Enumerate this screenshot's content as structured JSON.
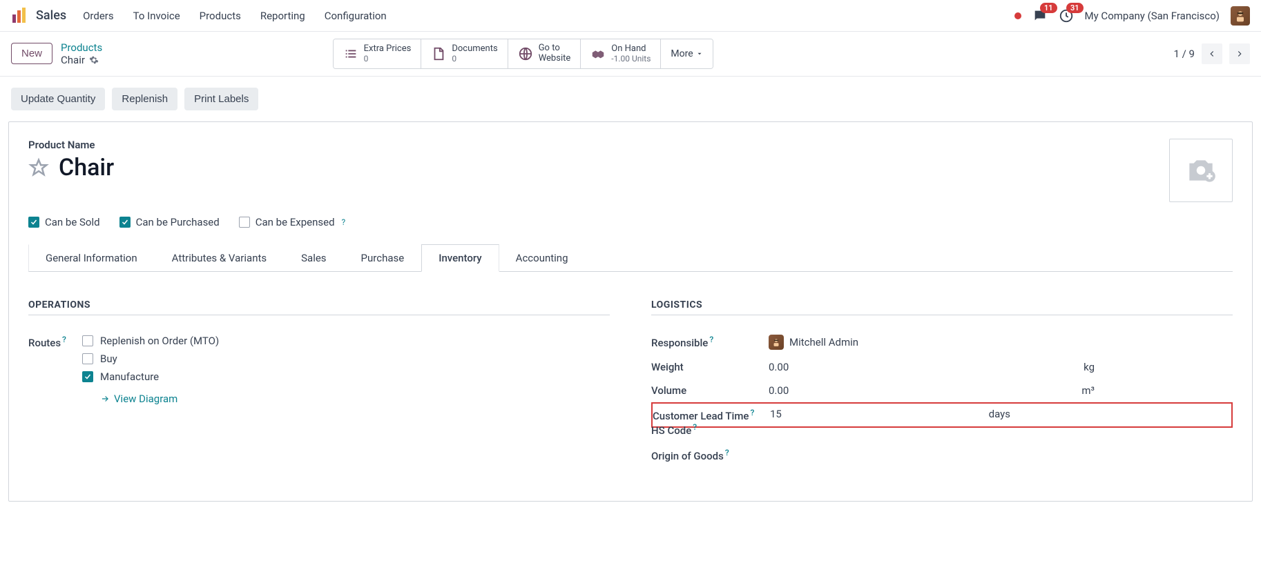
{
  "topnav": {
    "app": "Sales",
    "items": [
      "Orders",
      "To Invoice",
      "Products",
      "Reporting",
      "Configuration"
    ],
    "messages_badge": "11",
    "activities_badge": "31",
    "company": "My Company (San Francisco)"
  },
  "control": {
    "new": "New",
    "breadcrumb_parent": "Products",
    "breadcrumb_current": "Chair",
    "stats": {
      "extra_prices": {
        "label": "Extra Prices",
        "value": "0"
      },
      "documents": {
        "label": "Documents",
        "value": "0"
      },
      "website": {
        "label1": "Go to",
        "label2": "Website"
      },
      "on_hand": {
        "label": "On Hand",
        "value": "-1.00 Units"
      },
      "more": "More"
    },
    "pager": "1 / 9"
  },
  "actions": {
    "update_qty": "Update Quantity",
    "replenish": "Replenish",
    "print_labels": "Print Labels"
  },
  "form": {
    "name_label": "Product Name",
    "name": "Chair",
    "can_be_sold": "Can be Sold",
    "can_be_purchased": "Can be Purchased",
    "can_be_expensed": "Can be Expensed"
  },
  "tabs": [
    "General Information",
    "Attributes & Variants",
    "Sales",
    "Purchase",
    "Inventory",
    "Accounting"
  ],
  "operations": {
    "title": "OPERATIONS",
    "routes_label": "Routes",
    "routes": {
      "mto": "Replenish on Order (MTO)",
      "buy": "Buy",
      "manufacture": "Manufacture"
    },
    "view_diagram": "View Diagram"
  },
  "logistics": {
    "title": "LOGISTICS",
    "responsible_label": "Responsible",
    "responsible_value": "Mitchell Admin",
    "weight_label": "Weight",
    "weight_value": "0.00",
    "weight_unit": "kg",
    "volume_label": "Volume",
    "volume_value": "0.00",
    "volume_unit": "m³",
    "lead_time_label": "Customer Lead Time",
    "lead_time_value": "15",
    "lead_time_unit": "days",
    "hs_code_label": "HS Code",
    "origin_label": "Origin of Goods"
  }
}
